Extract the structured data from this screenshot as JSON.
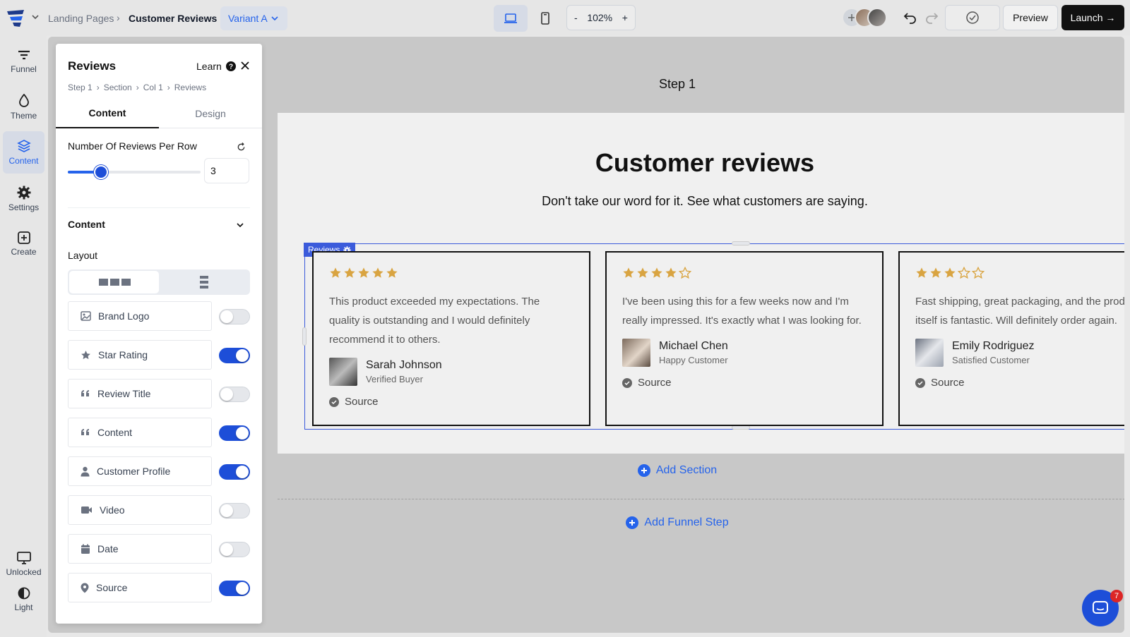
{
  "topbar": {
    "breadcrumb": [
      "Landing Pages",
      "Customer Reviews"
    ],
    "variant_label": "Variant A",
    "zoom_minus": "-",
    "zoom_level": "102%",
    "zoom_plus": "+",
    "preview_label": "Preview",
    "launch_label": "Launch →"
  },
  "rail": {
    "items": [
      {
        "label": "Funnel",
        "icon": "funnel-icon"
      },
      {
        "label": "Theme",
        "icon": "droplet-icon"
      },
      {
        "label": "Content",
        "icon": "layers-icon"
      },
      {
        "label": "Settings",
        "icon": "gear-icon"
      },
      {
        "label": "Create",
        "icon": "plus-square-icon"
      }
    ],
    "bottom": [
      {
        "label": "Unlocked",
        "icon": "monitor-icon"
      },
      {
        "label": "Light",
        "icon": "contrast-icon"
      }
    ]
  },
  "panel": {
    "title": "Reviews",
    "learn": "Learn",
    "crumbs": [
      "Step 1",
      "Section",
      "Col 1",
      "Reviews"
    ],
    "tabs": [
      "Content",
      "Design"
    ],
    "per_row_label": "Number Of Reviews Per Row",
    "per_row_value": "3",
    "per_row_fraction": 0.25,
    "content_header": "Content",
    "layout_label": "Layout",
    "options": [
      {
        "label": "Brand Logo",
        "icon": "image-icon",
        "on": false
      },
      {
        "label": "Star Rating",
        "icon": "star-icon",
        "on": true
      },
      {
        "label": "Review Title",
        "icon": "quote-icon",
        "on": false
      },
      {
        "label": "Content",
        "icon": "quote-icon",
        "on": true
      },
      {
        "label": "Customer Profile",
        "icon": "user-icon",
        "on": true
      },
      {
        "label": "Video",
        "icon": "video-icon",
        "on": false
      },
      {
        "label": "Date",
        "icon": "calendar-icon",
        "on": false
      },
      {
        "label": "Source",
        "icon": "map-pin-icon",
        "on": true
      }
    ]
  },
  "canvas": {
    "step_title": "Step 1",
    "section_title": "Customer reviews",
    "section_subtitle": "Don't take our word for it. See what customers are saying.",
    "reviews_tag": "Reviews",
    "add_section": "Add Section",
    "add_funnel_step": "Add Funnel Step",
    "chat_badge": "7"
  },
  "reviews": [
    {
      "rating": 5,
      "text": "This product exceeded my expectations. The\nquality is outstanding and I would definitely\nrecommend it to others.",
      "name": "Sarah Johnson",
      "role": "Verified Buyer",
      "source": "Source"
    },
    {
      "rating": 4,
      "text": "I've been using this for a few weeks now and I'm\nreally impressed. It's exactly what I was looking for.",
      "name": "Michael Chen",
      "role": "Happy Customer",
      "source": "Source"
    },
    {
      "rating": 3,
      "text": "Fast shipping, great packaging, and the product\nitself is fantastic. Will definitely order again.",
      "name": "Emily Rodriguez",
      "role": "Satisfied Customer",
      "source": "Source"
    }
  ],
  "colors": {
    "accent": "#2563eb",
    "star": "#d9a441",
    "tag": "#3b5bdb"
  }
}
